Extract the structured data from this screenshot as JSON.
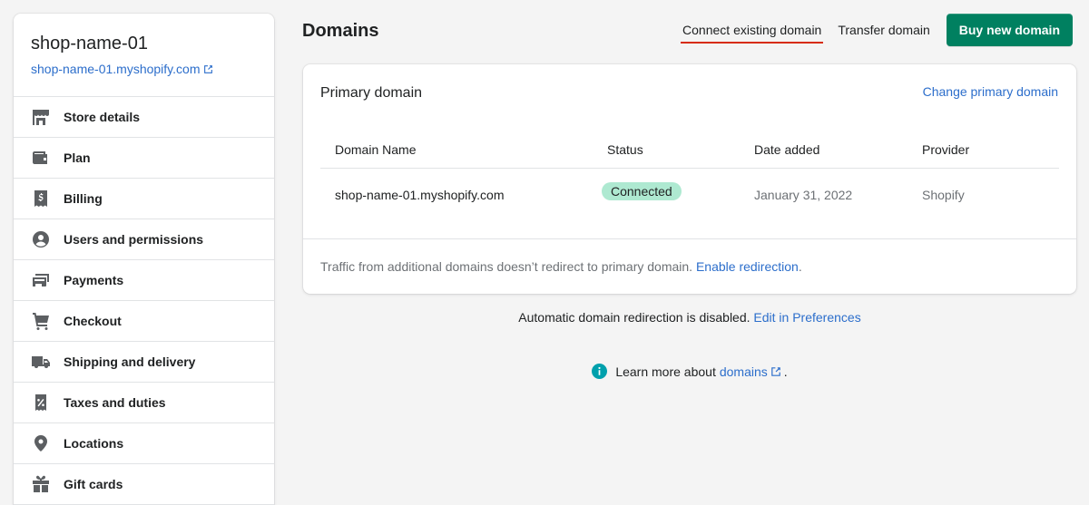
{
  "store": {
    "name": "shop-name-01",
    "url": "shop-name-01.myshopify.com"
  },
  "sidebar": {
    "items": [
      {
        "label": "Store details",
        "icon": "store-icon"
      },
      {
        "label": "Plan",
        "icon": "wallet-icon"
      },
      {
        "label": "Billing",
        "icon": "billing-icon"
      },
      {
        "label": "Users and permissions",
        "icon": "user-icon"
      },
      {
        "label": "Payments",
        "icon": "payments-icon"
      },
      {
        "label": "Checkout",
        "icon": "cart-icon"
      },
      {
        "label": "Shipping and delivery",
        "icon": "truck-icon"
      },
      {
        "label": "Taxes and duties",
        "icon": "tax-icon"
      },
      {
        "label": "Locations",
        "icon": "location-pin-icon"
      },
      {
        "label": "Gift cards",
        "icon": "gift-icon"
      }
    ]
  },
  "header": {
    "title": "Domains",
    "connect_label": "Connect existing domain",
    "transfer_label": "Transfer domain",
    "buy_label": "Buy new domain"
  },
  "primary_card": {
    "title": "Primary domain",
    "change_label": "Change primary domain",
    "columns": [
      "Domain Name",
      "Status",
      "Date added",
      "Provider"
    ],
    "row": {
      "domain": "shop-name-01.myshopify.com",
      "status": "Connected",
      "date_added": "January 31, 2022",
      "provider": "Shopify"
    },
    "footer_text": "Traffic from additional domains doesn’t redirect to primary domain.",
    "footer_link": "Enable redirection",
    "footer_end": "."
  },
  "redirect_note": {
    "text": "Automatic domain redirection is disabled.",
    "link": "Edit in Preferences"
  },
  "learn_more": {
    "text": "Learn more about",
    "link": "domains",
    "end": "."
  },
  "colors": {
    "primary_button": "#008060",
    "link": "#2c6ecb",
    "badge_success": "#aee9d1",
    "active_underline": "#d72c0d"
  }
}
